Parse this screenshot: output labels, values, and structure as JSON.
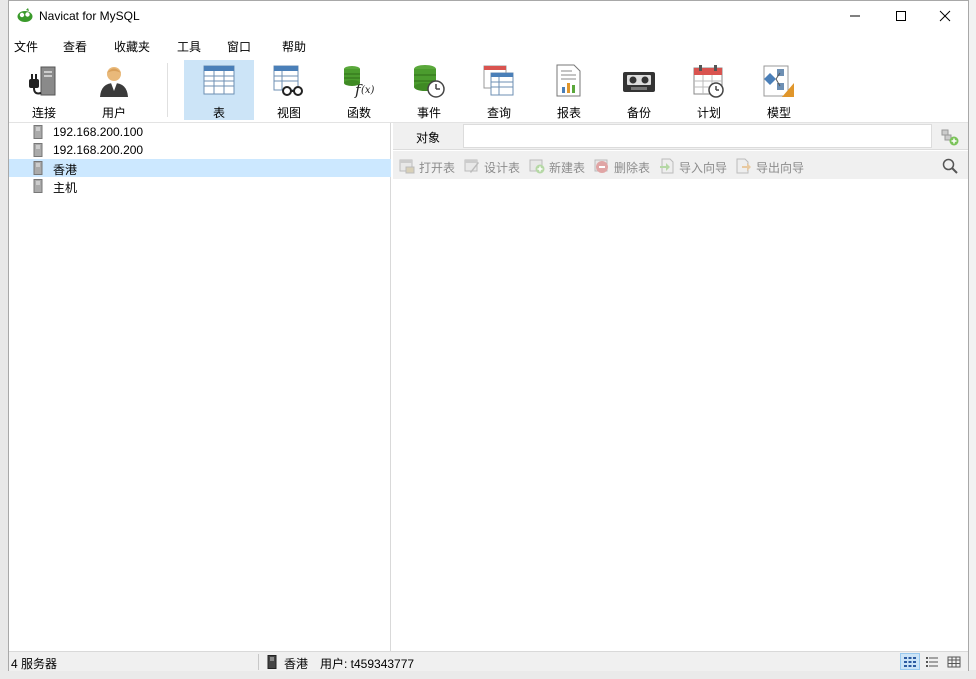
{
  "window": {
    "title": "Navicat for MySQL"
  },
  "menu": [
    "文件",
    "查看",
    "收藏夹",
    "工具",
    "窗口",
    "帮助"
  ],
  "toolbar": {
    "items": [
      {
        "label": "连接",
        "icon": "connection-icon"
      },
      {
        "label": "用户",
        "icon": "user-icon"
      },
      {
        "label": "表",
        "icon": "table-icon",
        "active": true
      },
      {
        "label": "视图",
        "icon": "view-icon"
      },
      {
        "label": "函数",
        "icon": "function-icon"
      },
      {
        "label": "事件",
        "icon": "event-icon"
      },
      {
        "label": "查询",
        "icon": "query-icon"
      },
      {
        "label": "报表",
        "icon": "report-icon"
      },
      {
        "label": "备份",
        "icon": "backup-icon"
      },
      {
        "label": "计划",
        "icon": "schedule-icon"
      },
      {
        "label": "模型",
        "icon": "model-icon"
      }
    ]
  },
  "tree": {
    "connections": [
      {
        "label": "192.168.200.100"
      },
      {
        "label": "192.168.200.200"
      },
      {
        "label": "香港",
        "selected": true
      },
      {
        "label": "主机"
      }
    ]
  },
  "objects": {
    "label": "对象",
    "search_value": "",
    "actions": [
      {
        "label": "打开表",
        "icon": "open-table-icon"
      },
      {
        "label": "设计表",
        "icon": "design-table-icon"
      },
      {
        "label": "新建表",
        "icon": "new-table-icon"
      },
      {
        "label": "删除表",
        "icon": "delete-table-icon"
      },
      {
        "label": "导入向导",
        "icon": "import-wizard-icon"
      },
      {
        "label": "导出向导",
        "icon": "export-wizard-icon"
      }
    ]
  },
  "status": {
    "count": "4 服务器",
    "connection": "香港",
    "user": "用户: t459343777"
  },
  "colors": {
    "selected_row": "#cce8ff",
    "active_tool": "#cce4f7",
    "logo_green": "#3a9a2b"
  }
}
